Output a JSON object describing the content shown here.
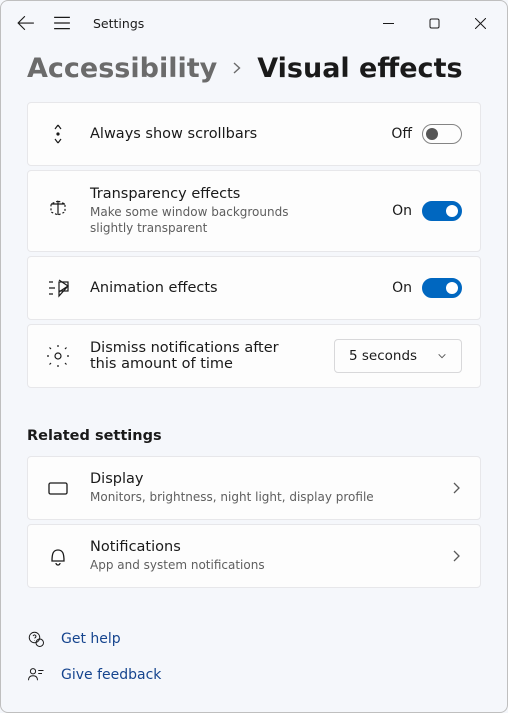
{
  "window": {
    "title": "Settings"
  },
  "breadcrumb": {
    "parent": "Accessibility",
    "current": "Visual effects"
  },
  "settings": {
    "scrollbars": {
      "title": "Always show scrollbars",
      "state": "Off"
    },
    "transparency": {
      "title": "Transparency effects",
      "sub": "Make some window backgrounds slightly transparent",
      "state": "On"
    },
    "animation": {
      "title": "Animation effects",
      "state": "On"
    },
    "dismiss": {
      "title": "Dismiss notifications after this amount of time",
      "value": "5 seconds"
    }
  },
  "related": {
    "heading": "Related settings",
    "display": {
      "title": "Display",
      "sub": "Monitors, brightness, night light, display profile"
    },
    "notifications": {
      "title": "Notifications",
      "sub": "App and system notifications"
    }
  },
  "footer": {
    "help": "Get help",
    "feedback": "Give feedback"
  }
}
